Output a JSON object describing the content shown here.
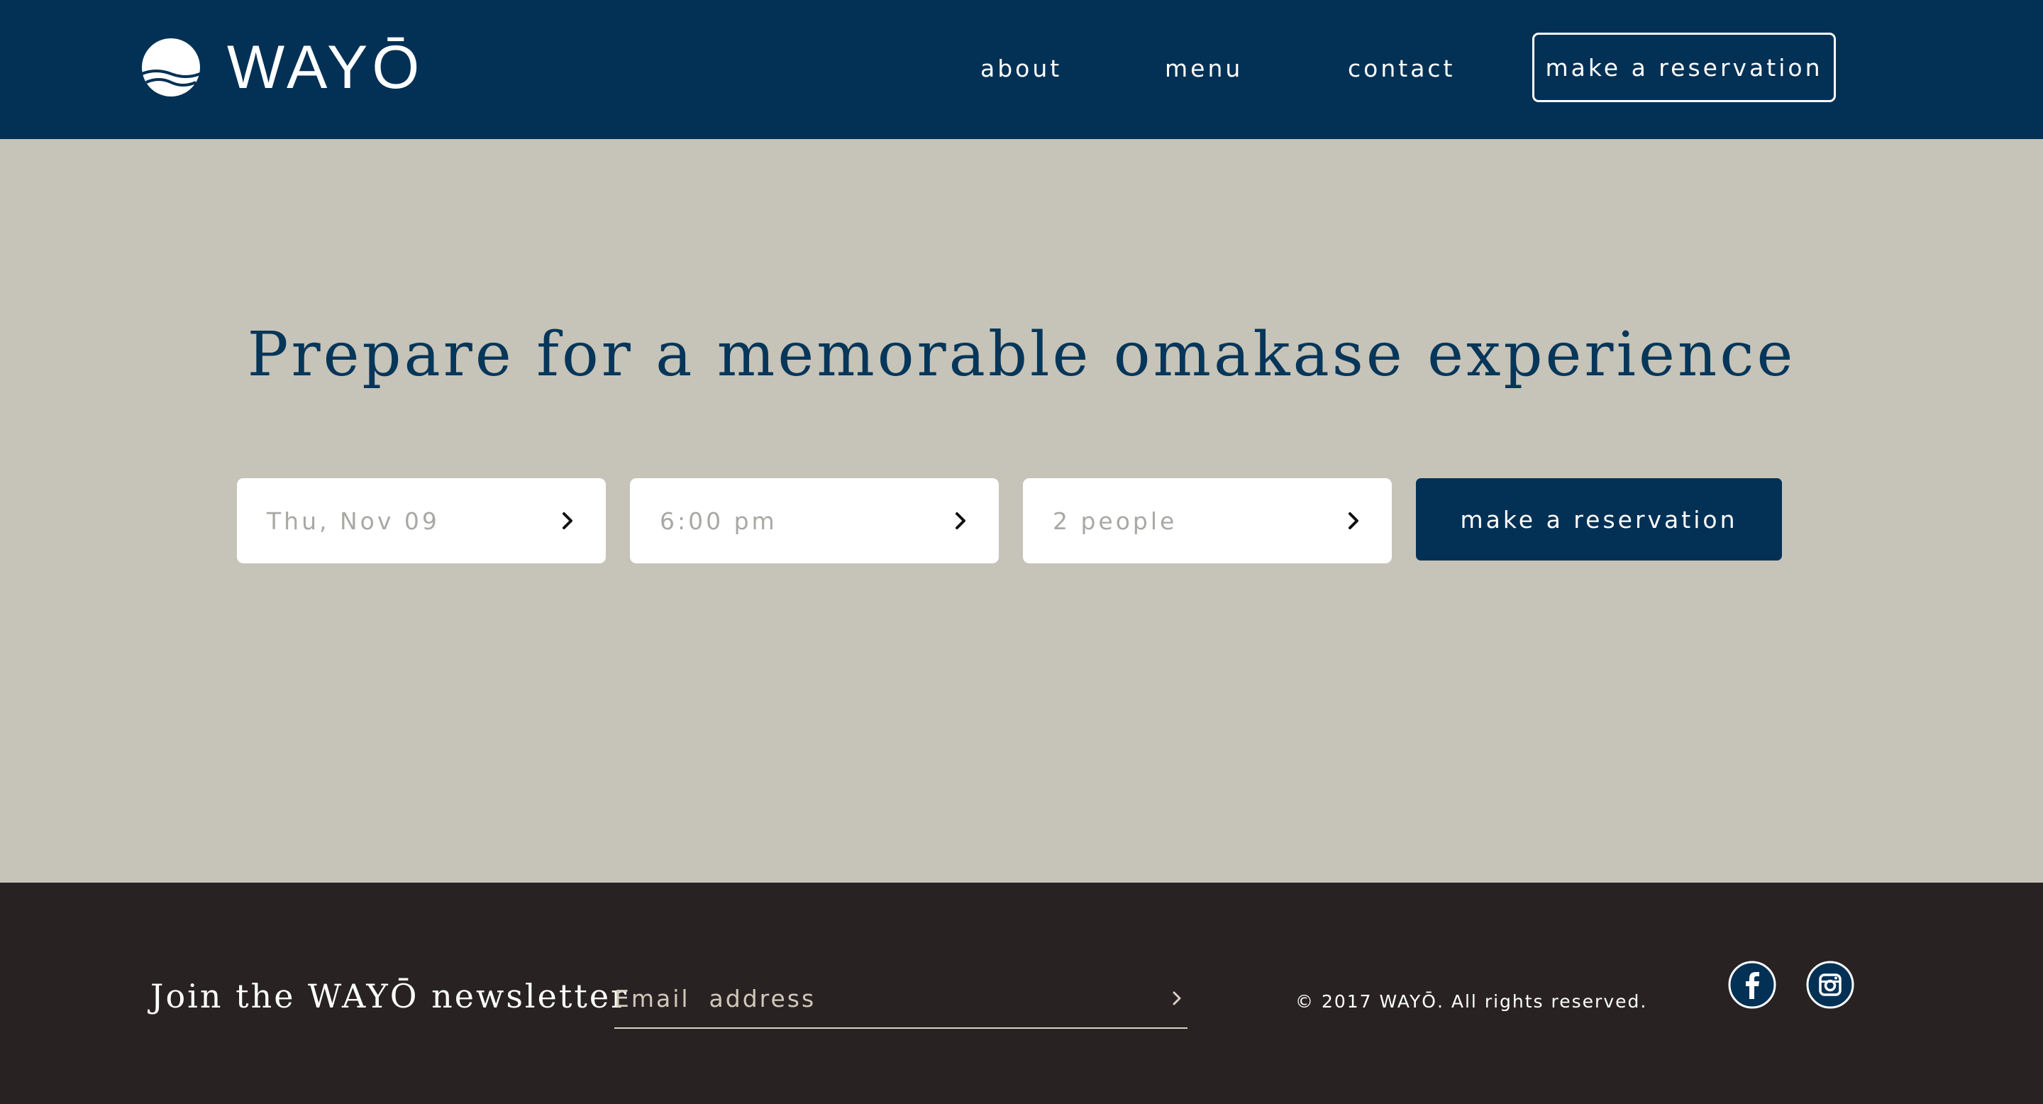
{
  "brand": {
    "name": "WAYŌ",
    "primary_color": "#033155",
    "background_color": "#c6c3b8",
    "footer_color": "#282322",
    "logo_icon": "sun-over-waves-logo"
  },
  "nav": {
    "links": [
      "about",
      "menu",
      "contact"
    ],
    "cta_label": "make a reservation"
  },
  "hero": {
    "headline": "Prepare for a memorable omakase experience",
    "date_value": "Thu, Nov 09",
    "time_value": "6:00 pm",
    "party_value": "2 people",
    "chevron_icon": "chevron-right-icon",
    "cta_label": "make a reservation"
  },
  "footer": {
    "newsletter_title": "Join the WAYŌ newsletter",
    "email_placeholder": "Email  address",
    "submit_icon": "chevron-right-icon",
    "copyright": "© 2017 WAYŌ. All rights reserved.",
    "social_icons": [
      "facebook-icon",
      "instagram-icon"
    ]
  }
}
